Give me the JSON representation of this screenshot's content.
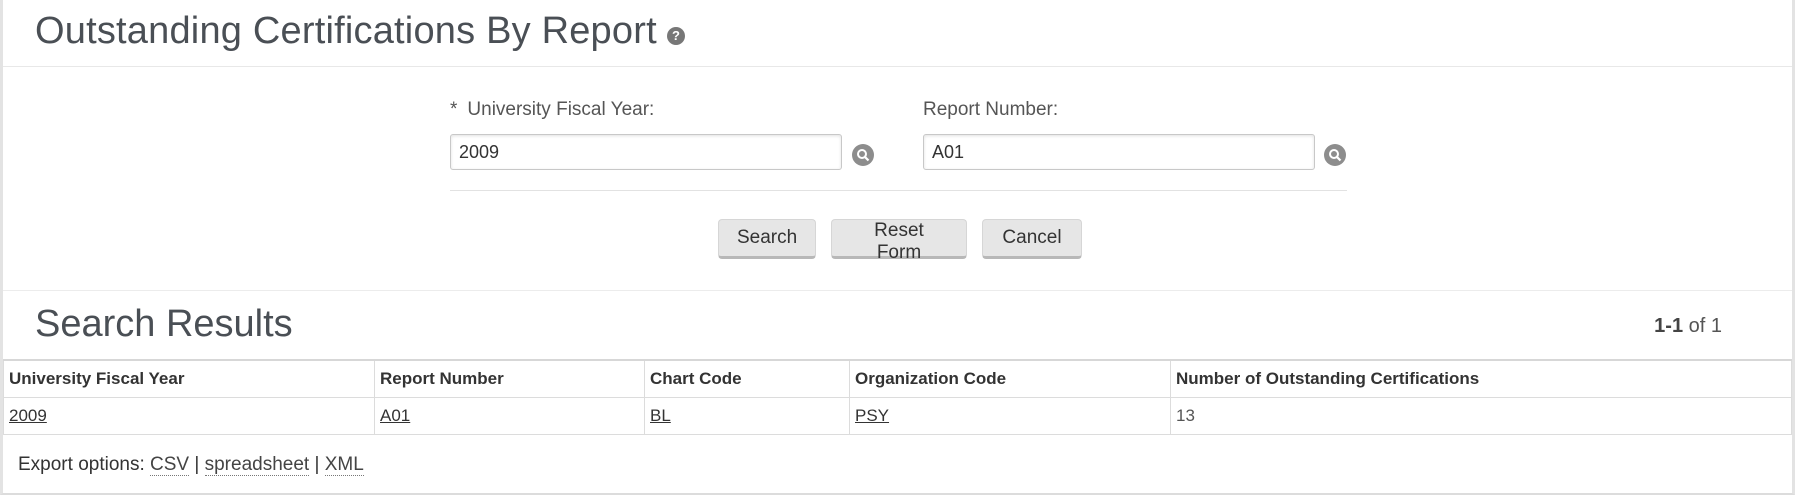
{
  "page": {
    "title": "Outstanding Certifications By Report",
    "help_icon": "question-circle-icon"
  },
  "form": {
    "fiscal_year": {
      "required_marker": "*",
      "label": "University Fiscal Year:",
      "value": "2009"
    },
    "report_number": {
      "label": "Report Number:",
      "value": "A01"
    },
    "lookup_icon": "magnifier-icon",
    "buttons": {
      "search": "Search",
      "reset": "Reset Form",
      "cancel": "Cancel"
    }
  },
  "results": {
    "title": "Search Results",
    "pager": {
      "range": "1-1",
      "of_text": "of 1"
    },
    "columns": [
      "University Fiscal Year",
      "Report Number",
      "Chart Code",
      "Organization Code",
      "Number of Outstanding Certifications"
    ],
    "rows": [
      {
        "fiscal_year": "2009",
        "report_number": "A01",
        "chart_code": "BL",
        "org_code": "PSY",
        "count": "13"
      }
    ]
  },
  "export": {
    "label": "Export options:",
    "csv": "CSV",
    "spreadsheet": "spreadsheet",
    "xml": "XML",
    "separator": "|"
  }
}
